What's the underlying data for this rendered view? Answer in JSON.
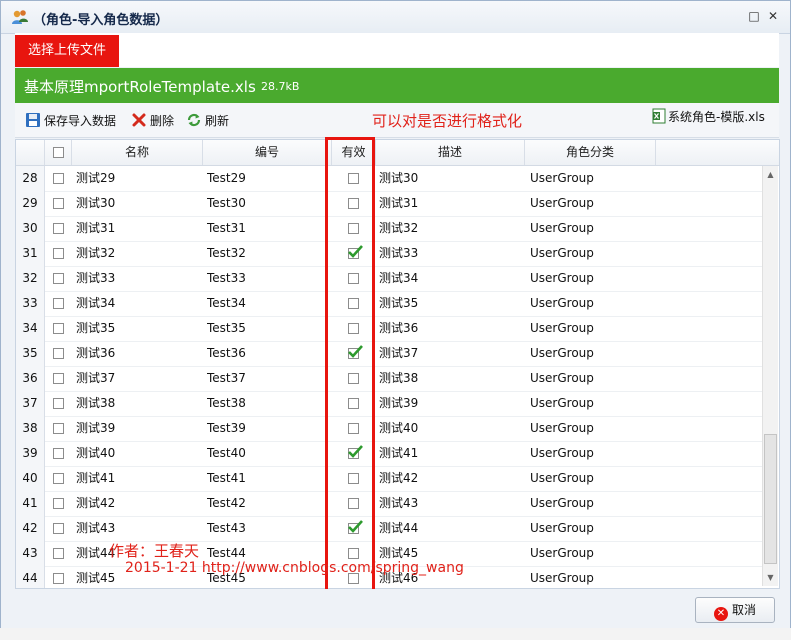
{
  "window": {
    "title": "（角色-导入角色数据）"
  },
  "upload": {
    "button_label": "选择上传文件"
  },
  "file": {
    "name": "基本原理mportRoleTemplate.xls",
    "size": "28.7kB"
  },
  "toolbar": {
    "save_label": "保存导入数据",
    "delete_label": "删除",
    "refresh_label": "刷新",
    "note": "可以对是否进行格式化",
    "template_label": "系统角色-模版.xls"
  },
  "table": {
    "headers": {
      "name": "名称",
      "code": "编号",
      "valid": "有效",
      "desc": "描述",
      "category": "角色分类"
    },
    "rows": [
      {
        "num": "28",
        "name": "测试29",
        "code": "Test29",
        "valid": false,
        "desc": "测试30",
        "category": "UserGroup"
      },
      {
        "num": "29",
        "name": "测试30",
        "code": "Test30",
        "valid": false,
        "desc": "测试31",
        "category": "UserGroup"
      },
      {
        "num": "30",
        "name": "测试31",
        "code": "Test31",
        "valid": false,
        "desc": "测试32",
        "category": "UserGroup"
      },
      {
        "num": "31",
        "name": "测试32",
        "code": "Test32",
        "valid": true,
        "desc": "测试33",
        "category": "UserGroup"
      },
      {
        "num": "32",
        "name": "测试33",
        "code": "Test33",
        "valid": false,
        "desc": "测试34",
        "category": "UserGroup"
      },
      {
        "num": "33",
        "name": "测试34",
        "code": "Test34",
        "valid": false,
        "desc": "测试35",
        "category": "UserGroup"
      },
      {
        "num": "34",
        "name": "测试35",
        "code": "Test35",
        "valid": false,
        "desc": "测试36",
        "category": "UserGroup"
      },
      {
        "num": "35",
        "name": "测试36",
        "code": "Test36",
        "valid": true,
        "desc": "测试37",
        "category": "UserGroup"
      },
      {
        "num": "36",
        "name": "测试37",
        "code": "Test37",
        "valid": false,
        "desc": "测试38",
        "category": "UserGroup"
      },
      {
        "num": "37",
        "name": "测试38",
        "code": "Test38",
        "valid": false,
        "desc": "测试39",
        "category": "UserGroup"
      },
      {
        "num": "38",
        "name": "测试39",
        "code": "Test39",
        "valid": false,
        "desc": "测试40",
        "category": "UserGroup"
      },
      {
        "num": "39",
        "name": "测试40",
        "code": "Test40",
        "valid": true,
        "desc": "测试41",
        "category": "UserGroup"
      },
      {
        "num": "40",
        "name": "测试41",
        "code": "Test41",
        "valid": false,
        "desc": "测试42",
        "category": "UserGroup"
      },
      {
        "num": "41",
        "name": "测试42",
        "code": "Test42",
        "valid": false,
        "desc": "测试43",
        "category": "UserGroup"
      },
      {
        "num": "42",
        "name": "测试43",
        "code": "Test43",
        "valid": true,
        "desc": "测试44",
        "category": "UserGroup"
      },
      {
        "num": "43",
        "name": "测试44",
        "code": "Test44",
        "valid": false,
        "desc": "测试45",
        "category": "UserGroup"
      },
      {
        "num": "44",
        "name": "测试45",
        "code": "Test45",
        "valid": false,
        "desc": "测试46",
        "category": "UserGroup"
      }
    ]
  },
  "watermark": {
    "author": "作者：王春天",
    "line2": "2015-1-21  http://www.cnblogs.com/spring_wang"
  },
  "footer": {
    "cancel_label": "取消"
  },
  "colors": {
    "accent_red": "#e8150f",
    "file_bar_green": "#4aaa2e",
    "check_green": "#2e9a2e"
  }
}
